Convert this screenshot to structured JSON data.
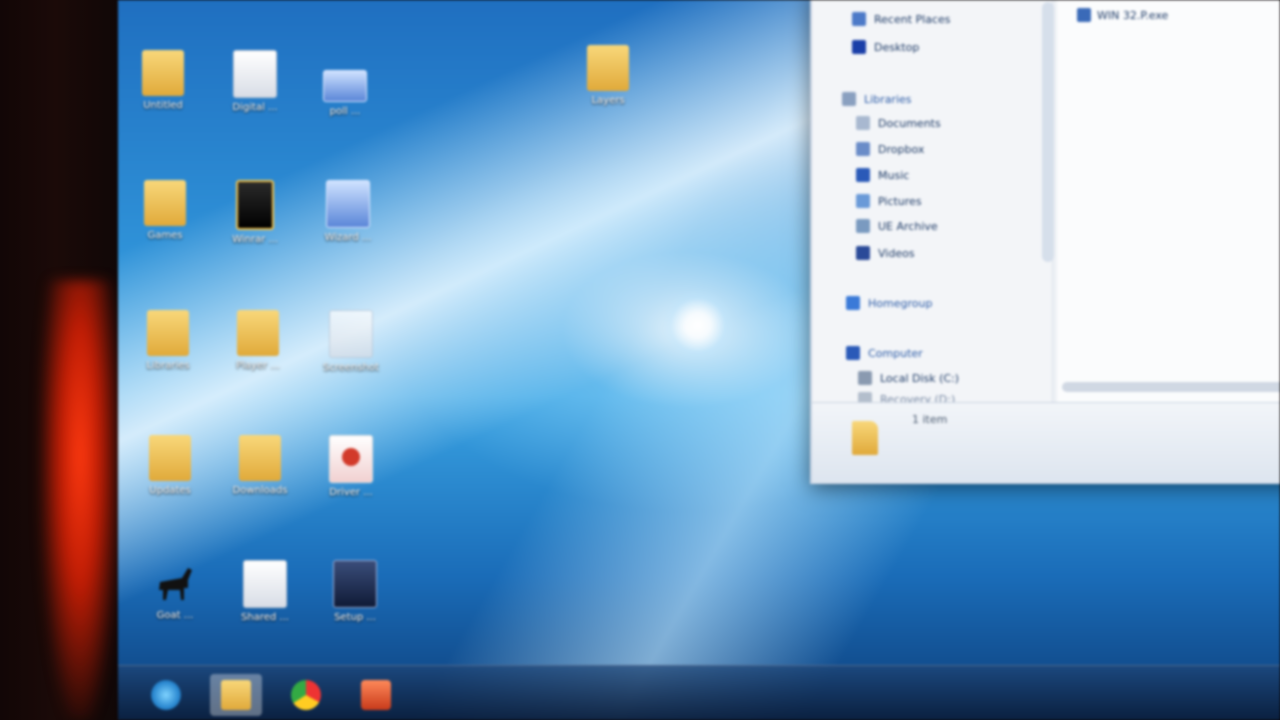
{
  "desktop": {
    "icons": [
      {
        "label": "Untitled",
        "kind": "folder"
      },
      {
        "label": "Digital ...",
        "kind": "doc"
      },
      {
        "label": "poll ...",
        "kind": "pic"
      },
      {
        "label": "Layers",
        "kind": "folder"
      },
      {
        "label": "Games",
        "kind": "folder"
      },
      {
        "label": "Winrar ...",
        "kind": "dark"
      },
      {
        "label": "Wizard ...",
        "kind": "pic"
      },
      {
        "label": "Libraries",
        "kind": "folder"
      },
      {
        "label": "Player ...",
        "kind": "folder"
      },
      {
        "label": "Screenshot",
        "kind": "doc"
      },
      {
        "label": "Updates",
        "kind": "folder"
      },
      {
        "label": "Downloads",
        "kind": "folder"
      },
      {
        "label": "Driver ...",
        "kind": "red"
      },
      {
        "label": "Goat ...",
        "kind": "animal"
      },
      {
        "label": "Shared ...",
        "kind": "doc"
      },
      {
        "label": "Setup ...",
        "kind": "app"
      }
    ]
  },
  "explorer": {
    "nav": {
      "favorites": [
        {
          "label": "Recent Places",
          "icon": "recent-places-icon"
        },
        {
          "label": "Desktop",
          "icon": "desktop-icon"
        }
      ],
      "libraries_label": "Libraries",
      "libraries": [
        {
          "label": "Documents",
          "icon": "documents-icon"
        },
        {
          "label": "Dropbox",
          "icon": "dropbox-icon"
        },
        {
          "label": "Music",
          "icon": "music-icon"
        },
        {
          "label": "Pictures",
          "icon": "pictures-icon"
        },
        {
          "label": "UE Archive",
          "icon": "archive-icon"
        },
        {
          "label": "Videos",
          "icon": "videos-icon"
        }
      ],
      "homegroup_label": "Homegroup",
      "computer_label": "Computer",
      "drives": [
        {
          "label": "Local Disk (C:)",
          "icon": "drive-icon"
        },
        {
          "label": "Recovery (D:)",
          "icon": "drive-icon"
        }
      ]
    },
    "content": {
      "file_label": "WIN 32.P.exe"
    },
    "status": {
      "items_count": "1 item"
    }
  },
  "taskbar": {
    "items": [
      {
        "name": "start-button"
      },
      {
        "name": "explorer-taskbar-button"
      },
      {
        "name": "chrome-taskbar-button"
      },
      {
        "name": "paint-taskbar-button"
      }
    ]
  }
}
